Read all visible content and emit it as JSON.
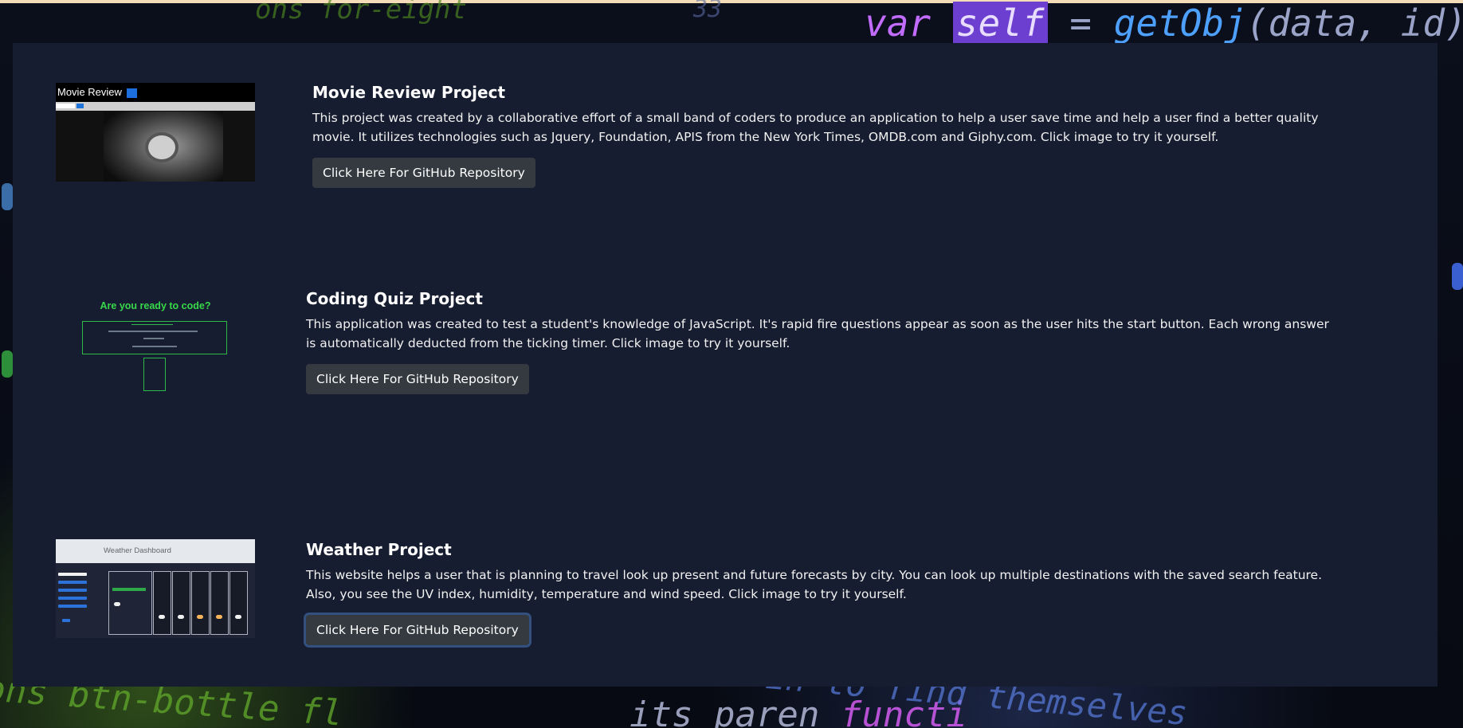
{
  "projects": [
    {
      "title": "Movie Review Project",
      "description": "This project was created by a collaborative effort of a small band of coders to produce an application to help a user save time and help a user find a better quality movie. It utilizes technologies such as Jquery, Foundation, APIS from the New York Times, OMDB.com and Giphy.com. Click image to try it yourself.",
      "button_label": "Click Here For GitHub Repository",
      "thumbnail": {
        "header_text": "Movie Review"
      }
    },
    {
      "title": "Coding Quiz Project",
      "description": "This application was created to test a student's knowledge of JavaScript. It's rapid fire questions appear as soon as the user hits the start button. Each wrong answer is automatically deducted from the ticking timer. Click image to try it yourself.",
      "button_label": "Click Here For GitHub Repository",
      "thumbnail": {
        "header_text": "Are you ready to code?"
      }
    },
    {
      "title": "Weather Project",
      "description": "This website helps a user that is planning to travel look up present and future forecasts by city. You can look up multiple destinations with the saved search feature. Also, you see the UV index, humidity, temperature and wind speed. Click image to try it yourself.",
      "button_label": "Click Here For GitHub Repository",
      "thumbnail": {
        "header_text": "Weather Dashboard"
      }
    }
  ],
  "background": {
    "code_top": {
      "kw": "var",
      "hl": "self",
      "eq": " = ",
      "fn": "getObj",
      "args": "(data, id)"
    },
    "code_bottom_left": "ons btn-bottle fl",
    "code_bottom_mid": {
      "text": "its paren",
      "fn": "functi"
    },
    "code_bottom_right": "in to find themselves",
    "code_top_left": "ons for-eight",
    "code_top_mid": "33"
  }
}
